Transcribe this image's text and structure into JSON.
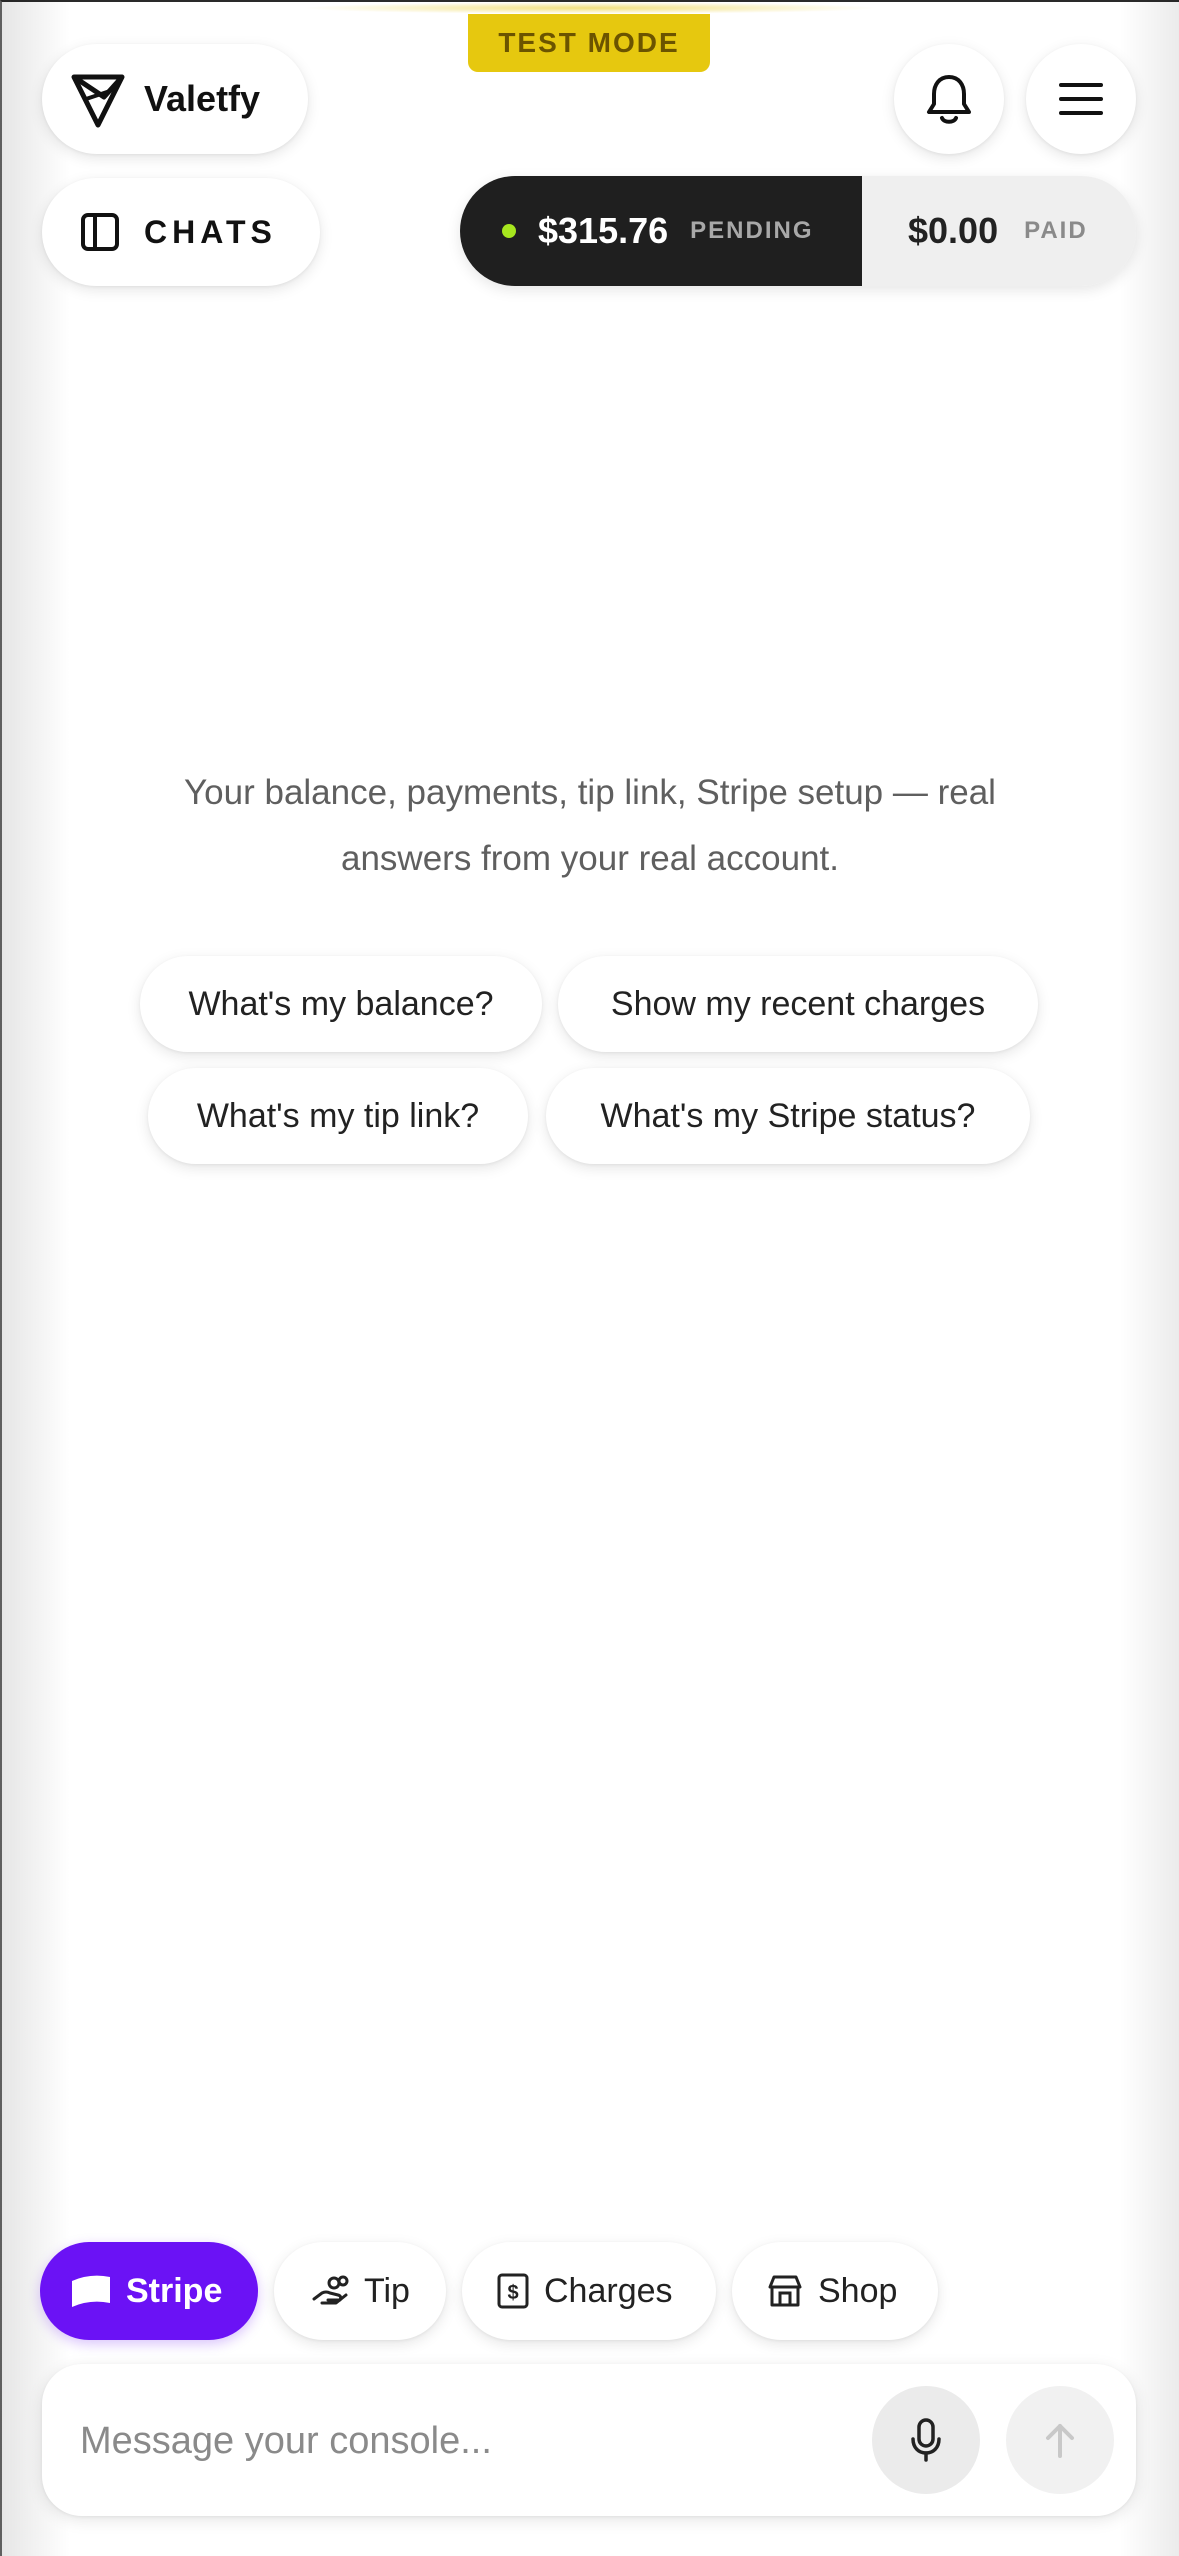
{
  "banner": {
    "label": "TEST MODE"
  },
  "header": {
    "brand_name": "Valetfy",
    "chats_label": "CHATS"
  },
  "balance": {
    "pending_amount": "$315.76",
    "pending_label": "PENDING",
    "paid_amount": "$0.00",
    "paid_label": "PAID",
    "status_dot_color": "#a6e61e"
  },
  "main": {
    "intro_line1": "Your balance, payments, tip link, Stripe setup — real",
    "intro_line2": "answers from your real account.",
    "suggestions": [
      "What's my balance?",
      "Show my recent charges",
      "What's my tip link?",
      "What's my Stripe status?"
    ]
  },
  "quick_actions": [
    {
      "label": "Stripe",
      "icon": "stripe-flag-icon"
    },
    {
      "label": "Tip",
      "icon": "tip-hand-icon"
    },
    {
      "label": "Charges",
      "icon": "receipt-icon"
    },
    {
      "label": "Shop",
      "icon": "storefront-icon"
    }
  ],
  "composer": {
    "placeholder": "Message your console..."
  },
  "colors": {
    "accent": "#6b12f5",
    "test_mode": "#e6c80f",
    "dark": "#1f1f1f"
  }
}
